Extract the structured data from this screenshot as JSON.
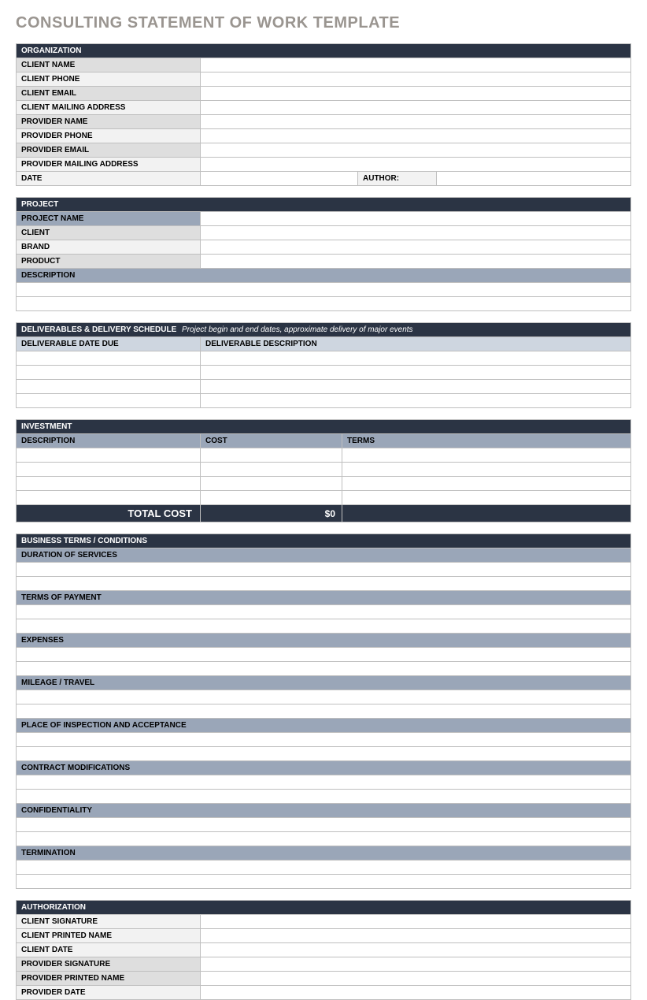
{
  "title": "CONSULTING STATEMENT OF WORK TEMPLATE",
  "organization": {
    "header": "ORGANIZATION",
    "clientName": "CLIENT NAME",
    "clientPhone": "CLIENT  PHONE",
    "clientEmail": "CLIENT EMAIL",
    "clientMailing": "CLIENT MAILING ADDRESS",
    "providerName": "PROVIDER NAME",
    "providerPhone": "PROVIDER PHONE",
    "providerEmail": "PROVIDER EMAIL",
    "providerMailing": "PROVIDER MAILING ADDRESS",
    "date": "DATE",
    "author": "AUTHOR:"
  },
  "project": {
    "header": "PROJECT",
    "projectName": "PROJECT NAME",
    "client": "CLIENT",
    "brand": "BRAND",
    "product": "PRODUCT",
    "description": "DESCRIPTION"
  },
  "deliverables": {
    "header": "DELIVERABLES & DELIVERY SCHEDULE",
    "hint": "Project begin and end dates, approximate delivery of major events",
    "colDate": "DELIVERABLE DATE DUE",
    "colDesc": "DELIVERABLE DESCRIPTION"
  },
  "investment": {
    "header": "INVESTMENT",
    "colDesc": "DESCRIPTION",
    "colCost": "COST",
    "colTerms": "TERMS",
    "totalLabel": "TOTAL COST",
    "totalValue": "$0"
  },
  "terms": {
    "header": "BUSINESS TERMS / CONDITIONS",
    "duration": "DURATION OF SERVICES",
    "payment": "TERMS OF PAYMENT",
    "expenses": "EXPENSES",
    "mileage": "MILEAGE / TRAVEL",
    "inspection": "PLACE OF INSPECTION AND ACCEPTANCE",
    "modifications": "CONTRACT MODIFICATIONS",
    "confidentiality": "CONFIDENTIALITY",
    "termination": "TERMINATION"
  },
  "authorization": {
    "header": "AUTHORIZATION",
    "clientSignature": "CLIENT SIGNATURE",
    "clientPrintedName": "CLIENT PRINTED NAME",
    "clientDate": "CLIENT DATE",
    "providerSignature": "PROVIDER SIGNATURE",
    "providerPrintedName": "PROVIDER PRINTED NAME",
    "providerDate": "PROVIDER DATE"
  }
}
